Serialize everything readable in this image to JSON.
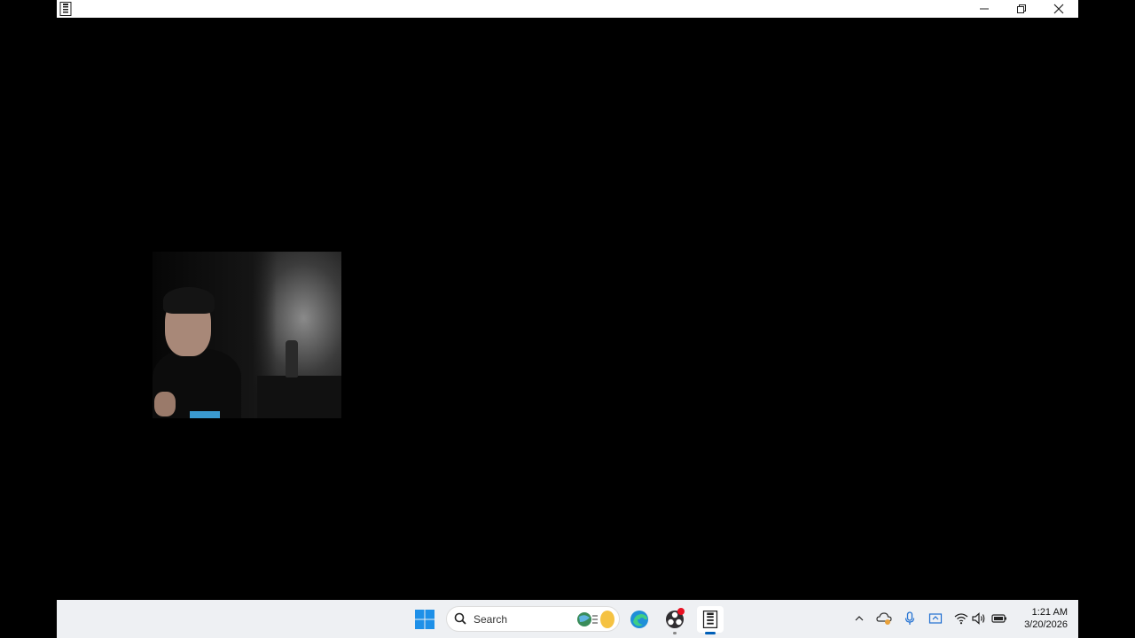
{
  "window": {
    "app_icon": "zip-archive-icon",
    "controls": {
      "minimize": "minimize-icon",
      "maximize": "restore-icon",
      "close": "close-icon"
    }
  },
  "content": {
    "webcam_overlay": "webcam-feed"
  },
  "taskbar": {
    "start": "windows-start-icon",
    "search": {
      "label": "Search",
      "icon": "search-icon"
    },
    "apps": [
      {
        "name": "Microsoft Edge",
        "icon": "edge-icon"
      },
      {
        "name": "OBS Studio",
        "icon": "obs-icon",
        "badge": "recording"
      },
      {
        "name": "Archive app",
        "icon": "zip-archive-icon",
        "active": true
      }
    ],
    "tray": {
      "icons": [
        "chevron-up-icon",
        "onedrive-icon",
        "microphone-icon",
        "display-icon",
        "wifi-icon",
        "volume-icon",
        "battery-icon"
      ]
    },
    "clock": {
      "time": "1:21 AM",
      "date": "3/20/2026"
    }
  },
  "colors": {
    "accent": "#005fb8",
    "recording_dot": "#e81123",
    "taskbar_bg": "#eef0f3"
  }
}
